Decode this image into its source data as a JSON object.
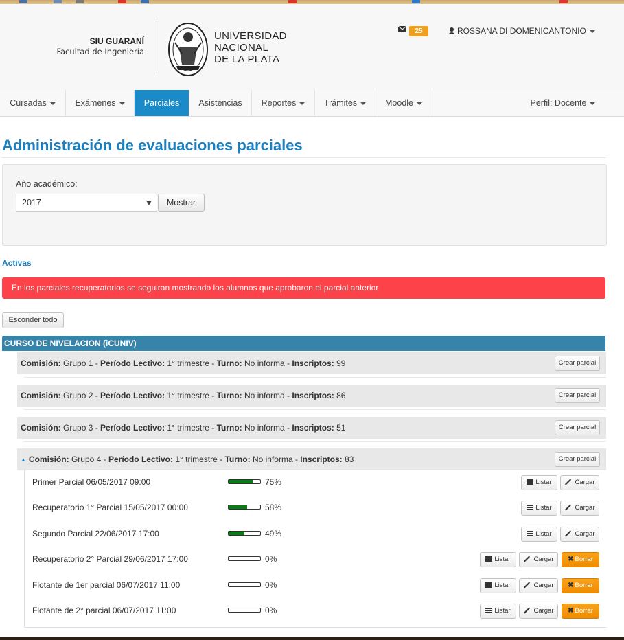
{
  "header": {
    "system_name": "SIU GUARANÍ",
    "faculty": "Facultad de Ingeniería",
    "university": [
      "UNIVERSIDAD",
      "NACIONAL",
      "DE LA PLATA"
    ],
    "messages_count": "25",
    "user_name": "ROSSANA DI DOMENICANTONIO"
  },
  "nav": {
    "items": [
      {
        "label": "Cursadas"
      },
      {
        "label": "Exámenes"
      },
      {
        "label": "Parciales"
      },
      {
        "label": "Asistencias"
      },
      {
        "label": "Reportes"
      },
      {
        "label": "Trámites"
      },
      {
        "label": "Moodle"
      }
    ],
    "profile": "Perfil: Docente"
  },
  "page": {
    "title": "Administración de evaluaciones parciales",
    "year_label": "Año académico:",
    "year_value": "2017",
    "show_button": "Mostrar",
    "section_active": "Activas",
    "alert": "En los parciales recuperatorios se seguiran mostrando los alumnos que aprobaron el parcial anterior",
    "hide_all_button": "Esconder todo",
    "course_title": "CURSO DE NIVELACION (iCUNIV)"
  },
  "labels": {
    "comision": "Comisión:",
    "periodo": "Período Lectivo:",
    "turno": "Turno:",
    "inscriptos": "Inscriptos:",
    "crear_parcial": "Crear parcial",
    "listar": "Listar",
    "cargar": "Cargar",
    "borrar": "Borrar"
  },
  "comisiones": [
    {
      "grupo": "Grupo 1",
      "periodo": "1° trimestre",
      "turno": "No informa",
      "inscriptos": "99"
    },
    {
      "grupo": "Grupo 2",
      "periodo": "1° trimestre",
      "turno": "No informa",
      "inscriptos": "86"
    },
    {
      "grupo": "Grupo 3",
      "periodo": "1° trimestre",
      "turno": "No informa",
      "inscriptos": "51"
    },
    {
      "grupo": "Grupo 4",
      "periodo": "1° trimestre",
      "turno": "No informa",
      "inscriptos": "83"
    }
  ],
  "parciales": [
    {
      "name": "Primer Parcial 06/05/2017 09:00",
      "progress": 0.75,
      "pct": "75%",
      "can_delete": false
    },
    {
      "name": "Recuperatorio 1° Parcial 15/05/2017 00:00",
      "progress": 0.58,
      "pct": "58%",
      "can_delete": false
    },
    {
      "name": "Segundo Parcial 22/06/2017 17:00",
      "progress": 0.49,
      "pct": "49%",
      "can_delete": false
    },
    {
      "name": "Recuperatorio 2° Parcial 29/06/2017 17:00",
      "progress": 0,
      "pct": "0%",
      "can_delete": true
    },
    {
      "name": "Flotante de 1er parcial 06/07/2017 11:00",
      "progress": 0,
      "pct": "0%",
      "can_delete": true
    },
    {
      "name": "Flotante de 2° parcial 06/07/2017 11:00",
      "progress": 0,
      "pct": "0%",
      "can_delete": true
    }
  ]
}
